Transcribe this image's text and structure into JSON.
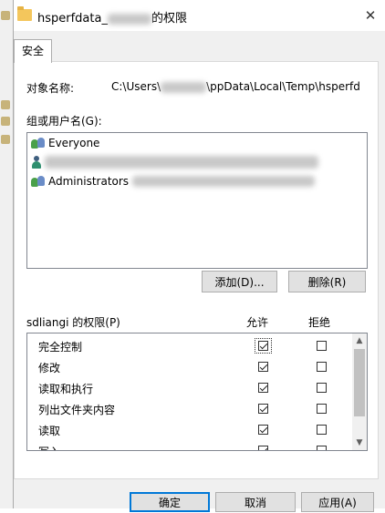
{
  "window": {
    "title_prefix": "hsperfdata_",
    "title_suffix": "的权限",
    "close_label": "✕"
  },
  "tab": {
    "label": "安全"
  },
  "object": {
    "label": "对象名称:",
    "path_prefix": "C:\\Users\\",
    "path_suffix": "\\ppData\\Local\\Temp\\hsperfd"
  },
  "groups": {
    "label": "组或用户名(G):",
    "items": [
      {
        "name": "Everyone",
        "icon": "users-group-icon"
      },
      {
        "name": "",
        "icon": "user-icon"
      },
      {
        "name": "Administrators",
        "icon": "users-group-icon"
      }
    ],
    "add_label": "添加(D)...",
    "remove_label": "删除(R)"
  },
  "permissions": {
    "label": "sdliangi 的权限(P)",
    "allow_header": "允许",
    "deny_header": "拒绝",
    "rows": [
      {
        "name": "完全控制",
        "allow": true,
        "deny": false
      },
      {
        "name": "修改",
        "allow": true,
        "deny": false
      },
      {
        "name": "读取和执行",
        "allow": true,
        "deny": false
      },
      {
        "name": "列出文件夹内容",
        "allow": true,
        "deny": false
      },
      {
        "name": "读取",
        "allow": true,
        "deny": false
      },
      {
        "name": "写入",
        "allow": true,
        "deny": false
      }
    ]
  },
  "footer": {
    "ok_label": "确定",
    "cancel_label": "取消",
    "apply_label": "应用(A)"
  },
  "colors": {
    "accent": "#0078d7",
    "window_bg": "#f0f0f0"
  }
}
